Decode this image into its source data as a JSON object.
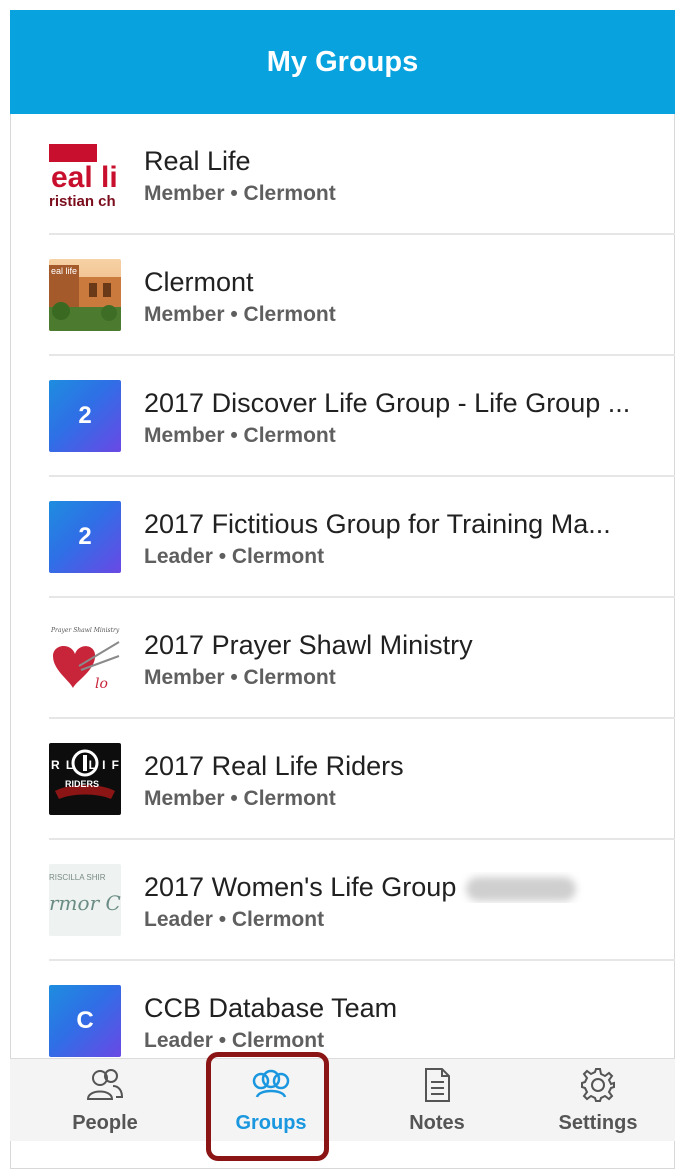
{
  "header": {
    "title": "My Groups"
  },
  "groups": [
    {
      "title": "Real Life",
      "subtitle": "Member • Clermont",
      "thumb": "real-life-logo"
    },
    {
      "title": "Clermont",
      "subtitle": "Member • Clermont",
      "thumb": "building-photo"
    },
    {
      "title": "2017 Discover Life Group - Life Group ...",
      "subtitle": "Member • Clermont",
      "thumb": "badge",
      "badge": "2"
    },
    {
      "title": "2017 Fictitious Group for Training Ma...",
      "subtitle": "Leader • Clermont",
      "thumb": "badge",
      "badge": "2"
    },
    {
      "title": "2017 Prayer Shawl Ministry",
      "subtitle": "Member • Clermont",
      "thumb": "yarn-heart"
    },
    {
      "title": "2017 Real Life Riders",
      "subtitle": "Member • Clermont",
      "thumb": "riders-logo"
    },
    {
      "title": "2017 Women's Life Group",
      "subtitle": "Leader • Clermont",
      "thumb": "script-logo"
    },
    {
      "title": "CCB Database Team",
      "subtitle": "Leader • Clermont",
      "thumb": "badge",
      "badge": "C"
    }
  ],
  "tabs": [
    {
      "label": "People",
      "icon": "people-icon",
      "active": false
    },
    {
      "label": "Groups",
      "icon": "groups-icon",
      "active": true
    },
    {
      "label": "Notes",
      "icon": "notes-icon",
      "active": false
    },
    {
      "label": "Settings",
      "icon": "gear-icon",
      "active": false
    }
  ],
  "colors": {
    "header": "#08a3df",
    "active_tab": "#1a97df",
    "highlight": "#8b1414"
  },
  "thumb_text": {
    "real_life_top": "eal li",
    "real_life_bottom": "ristian ch",
    "real_life_small": "eal life",
    "prayer_script": "Prayer Shawl Ministry",
    "riders_top": "RL LIF",
    "riders_bottom": "RIDERS",
    "women_top": "RISCILLA SHIR",
    "women_script": "rmor C"
  }
}
